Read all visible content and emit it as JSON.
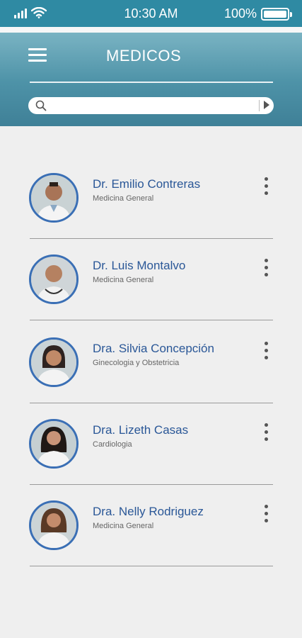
{
  "status_bar": {
    "time": "10:30 AM",
    "battery": "100%"
  },
  "header": {
    "title": "MEDICOS",
    "menu_icon": "hamburger-menu-icon"
  },
  "search": {
    "placeholder": "",
    "value": ""
  },
  "doctors": [
    {
      "name": "Dr. Emilio Contreras",
      "specialty": "Medicina General"
    },
    {
      "name": "Dr. Luis Montalvo",
      "specialty": "Medicina General"
    },
    {
      "name": "Dra. Silvia Concepción",
      "specialty": "Ginecologia y Obstetricia"
    },
    {
      "name": "Dra. Lizeth Casas",
      "specialty": "Cardiologia"
    },
    {
      "name": "Dra. Nelly Rodriguez",
      "specialty": "Medicina General"
    }
  ],
  "colors": {
    "status_bar": "#2f8aa3",
    "header_gradient_top": "#7fb7c6",
    "header_gradient_bottom": "#3f8097",
    "name_text": "#2a5797",
    "avatar_ring": "#3a6fb5",
    "background": "#efefef"
  }
}
